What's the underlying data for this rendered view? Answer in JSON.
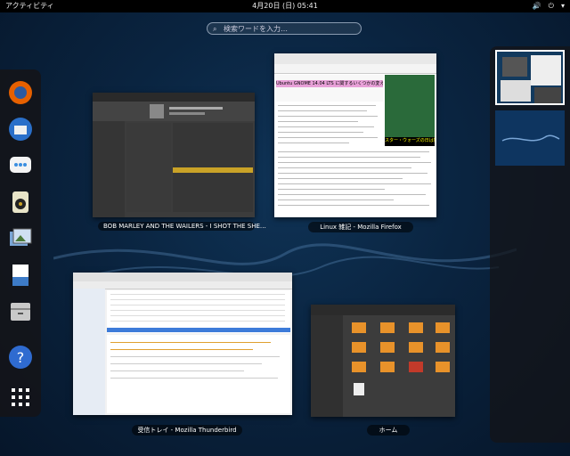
{
  "topbar": {
    "activities_label": "アクティビティ",
    "clock": "4月20日 (日) 05:41",
    "system_icons": [
      "speaker-icon",
      "power-icon",
      "chevron-down-icon"
    ]
  },
  "search": {
    "placeholder": "検索ワードを入力…",
    "icon": "search-icon"
  },
  "dash": {
    "apps": [
      {
        "name": "firefox-launcher",
        "icon": "firefox-icon",
        "color": "#e66000"
      },
      {
        "name": "thunderbird-launcher",
        "icon": "thunderbird-icon",
        "color": "#2a6fc9"
      },
      {
        "name": "empathy-launcher",
        "icon": "chat-icon",
        "color": "#3b8fe0"
      },
      {
        "name": "rhythmbox-launcher",
        "icon": "speaker-icon",
        "color": "#e8e4c8"
      },
      {
        "name": "shotwell-launcher",
        "icon": "photos-icon",
        "color": "#7aa6d6"
      },
      {
        "name": "writer-launcher",
        "icon": "document-icon",
        "color": "#3d7bc7"
      },
      {
        "name": "files-launcher",
        "icon": "file-cabinet-icon",
        "color": "#c9c9c9"
      },
      {
        "name": "help-launcher",
        "icon": "help-icon",
        "color": "#2f6bd0"
      },
      {
        "name": "show-apps-launcher",
        "icon": "grid-icon",
        "color": "#ffffff"
      }
    ]
  },
  "windows": [
    {
      "id": "rhythmbox",
      "caption": "BOB MARLEY AND THE WAILERS - I SHOT THE SHE…"
    },
    {
      "id": "firefox",
      "caption": "Linux 雑記 - Mozilla Firefox",
      "page_title": "Ubuntu GNOME 14.04 LTS に関するいくつかの変え書き",
      "ad_text": "スター・ウォーズの日は好き?"
    },
    {
      "id": "thunderbird",
      "caption": "受信トレイ - Mozilla Thunderbird"
    },
    {
      "id": "nautilus",
      "caption": "ホーム"
    }
  ],
  "workspaces": [
    "workspace-1",
    "workspace-2"
  ]
}
